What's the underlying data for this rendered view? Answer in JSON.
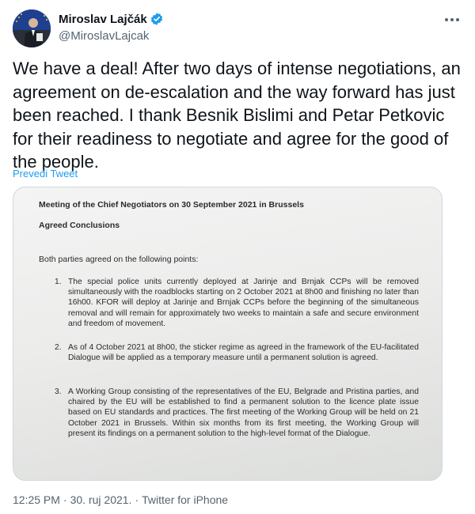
{
  "author": {
    "display_name": "Miroslav Lajčák",
    "handle": "@MiroslavLajcak",
    "verified_icon": "verified-badge-icon",
    "more_icon": "more-options-icon"
  },
  "tweet": {
    "text": "We have a deal! After two days of intense negotiations, an agreement on de-escalation and the way forward has just been reached. I thank Besnik Bislimi and Petar Petkovic for their readiness to negotiate and agree for the good of the people.",
    "translate_label": "Prevedi Tweet"
  },
  "document": {
    "title": "Meeting of the Chief Negotiators on 30 September 2021 in Brussels",
    "subtitle": "Agreed Conclusions",
    "intro": "Both parties agreed on the following points:",
    "items": [
      {
        "number": "1.",
        "text": "The special police units currently deployed at Jarinje and Brnjak CCPs will be removed simultaneously with the roadblocks starting on 2 October 2021 at 8h00 and finishing no later than 16h00. KFOR will deploy at Jarinje and Brnjak CCPs before the beginning of the simultaneous removal and will remain for approximately two weeks to maintain a safe and secure environment and freedom of movement."
      },
      {
        "number": "2.",
        "text": "As of 4 October 2021 at 8h00, the sticker regime as agreed in the framework of the EU-facilitated Dialogue will be applied as a temporary measure until a permanent solution is agreed."
      },
      {
        "number": "3.",
        "text": "A Working Group consisting of the representatives of the EU, Belgrade and Pristina parties, and chaired by the EU will be established to find a permanent solution to the licence plate issue based on EU standards and practices. The first meeting of the Working Group will be held on 21 October 2021 in Brussels. Within six months from its first meeting, the Working Group will present its findings on a permanent solution to the high-level format of the Dialogue."
      }
    ]
  },
  "footer": {
    "time": "12:25 PM",
    "separator": "·",
    "date": "30. ruj 2021.",
    "source": "Twitter for iPhone"
  },
  "colors": {
    "accent": "#1d9bf0",
    "text_primary": "#0f1419",
    "text_secondary": "#536471",
    "border": "#cfd9de"
  }
}
